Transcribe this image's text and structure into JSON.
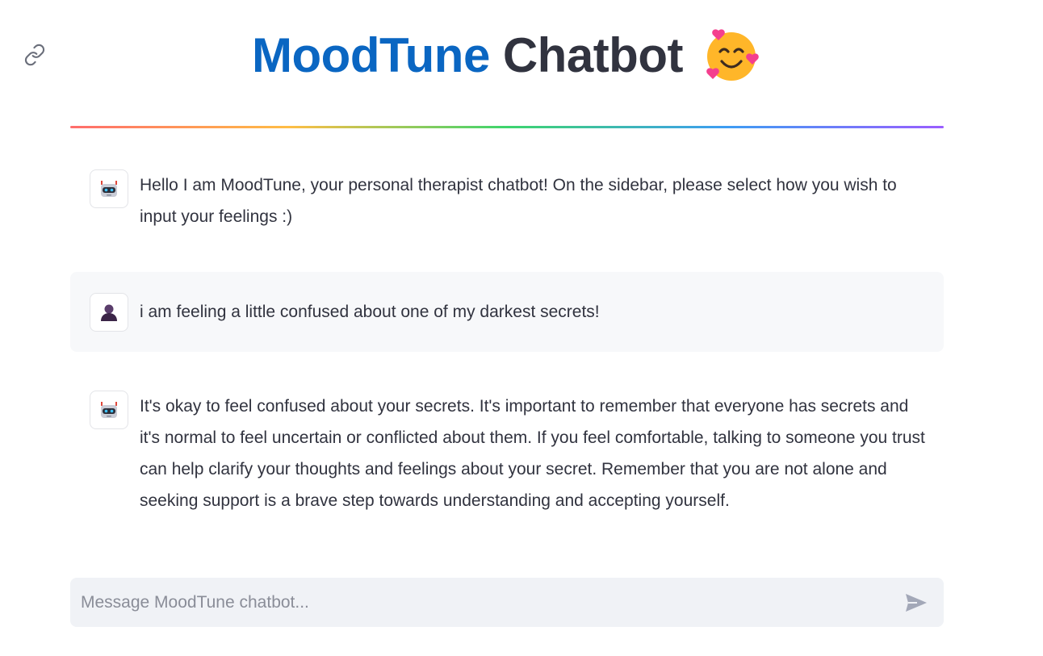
{
  "header": {
    "title_brand": "MoodTune",
    "title_rest": "Chatbot",
    "title_emoji_icon": "smiling-face-with-hearts-icon"
  },
  "link_icon": "link-icon",
  "messages": [
    {
      "role": "assistant",
      "avatar_icon": "robot-icon",
      "text": "Hello I am MoodTune, your personal therapist chatbot! On the sidebar, please select how you wish to input your feelings :)"
    },
    {
      "role": "user",
      "avatar_icon": "person-icon",
      "text": "i am feeling a little confused about one of my darkest secrets!"
    },
    {
      "role": "assistant",
      "avatar_icon": "robot-icon",
      "text": "It's okay to feel confused about your secrets. It's important to remember that everyone has secrets and it's normal to feel uncertain or conflicted about them. If you feel comfortable, talking to someone you trust can help clarify your thoughts and feelings about your secret. Remember that you are not alone and seeking support is a brave step towards understanding and accepting yourself."
    }
  ],
  "chat_input": {
    "placeholder": "Message MoodTune chatbot...",
    "value": "",
    "send_icon": "send-icon"
  },
  "colors": {
    "brand": "#0a66c2",
    "text": "#31333f",
    "user_bg": "#f7f8fa",
    "input_bg": "#f0f2f6"
  }
}
